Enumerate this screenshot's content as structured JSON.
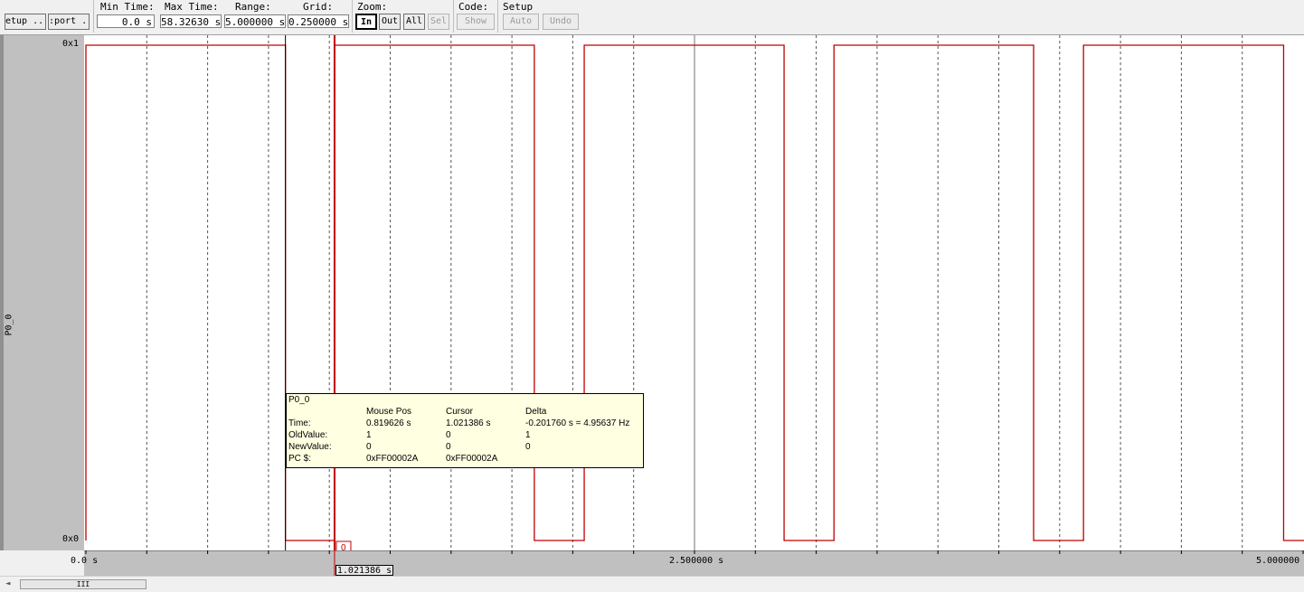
{
  "toolbar": {
    "setup_btn": "etup ...",
    "export_btn": ":port ...",
    "min_time_label": "Min Time:",
    "min_time_value": "0.0 s",
    "max_time_label": "Max Time:",
    "max_time_value": "58.32630 s",
    "range_label": "Range:",
    "range_value": "5.000000 s",
    "grid_label": "Grid:",
    "grid_value": "0.250000 s",
    "zoom_label": "Zoom:",
    "zoom_in": "In",
    "zoom_out": "Out",
    "zoom_all": "All",
    "zoom_sel": "Sel",
    "code_label": "Code:",
    "code_show": "Show",
    "setup_label": "Setup",
    "setup_auto": "Auto",
    "setup_undo": "Undo"
  },
  "signal": {
    "name": "P0_0",
    "y_high": "0x1",
    "y_low": "0x0",
    "color": "#c00000"
  },
  "waveform": {
    "view_start_s": 0.0,
    "view_range_s": 5.0,
    "grid_s": 0.25,
    "transitions": [
      {
        "t": 0.0,
        "v": 1
      },
      {
        "t": 0.819626,
        "v": 0
      },
      {
        "t": 1.021386,
        "v": 1
      },
      {
        "t": 1.842,
        "v": 0
      },
      {
        "t": 2.047,
        "v": 1
      },
      {
        "t": 2.868,
        "v": 0
      },
      {
        "t": 3.073,
        "v": 1
      },
      {
        "t": 3.893,
        "v": 0
      },
      {
        "t": 4.098,
        "v": 1
      },
      {
        "t": 4.92,
        "v": 0
      }
    ],
    "cursor_s": 1.021386,
    "mouse_s": 0.819626,
    "cursor_marker_value": "0"
  },
  "axis": {
    "label_left": "0.0 s",
    "label_mid": "2.500000 s",
    "label_right": "5.000000",
    "cursor_readout": "1.021386  s"
  },
  "tooltip": {
    "title": "P0_0",
    "col_mouse": "Mouse Pos",
    "col_cursor": "Cursor",
    "col_delta": "Delta",
    "rows": [
      {
        "label": "Time:",
        "mouse": "0.819626 s",
        "cursor": "1.021386 s",
        "delta": "-0.201760 s = 4.95637 Hz"
      },
      {
        "label": "OldValue:",
        "mouse": "1",
        "cursor": "0",
        "delta": "1"
      },
      {
        "label": "NewValue:",
        "mouse": "0",
        "cursor": "0",
        "delta": "0"
      },
      {
        "label": "PC $:",
        "mouse": "0xFF00002A",
        "cursor": "0xFF00002A",
        "delta": ""
      }
    ]
  },
  "scrollbar": {
    "thumb_grip": "III"
  }
}
